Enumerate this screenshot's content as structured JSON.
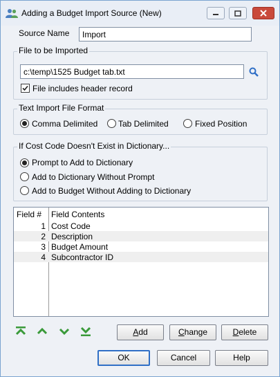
{
  "window": {
    "title": "Adding a Budget Import Source  (New)"
  },
  "source": {
    "label": "Source Name",
    "value": "Import"
  },
  "file_group": {
    "label": "File to be Imported",
    "path": "c:\\temp\\1525 Budget tab.txt",
    "header_checkbox_label": "File includes header record",
    "header_checked": true
  },
  "format_group": {
    "label": "Text Import File Format",
    "options": [
      "Comma Delimited",
      "Tab Delimited",
      "Fixed Position"
    ],
    "selected": 0
  },
  "cost_group": {
    "label": "If Cost Code Doesn't Exist in Dictionary...",
    "options": [
      "Prompt to Add to Dictionary",
      "Add to Dictionary Without Prompt",
      "Add to Budget Without Adding to Dictionary"
    ],
    "selected": 0
  },
  "fields": {
    "col_number": "Field #",
    "col_contents": "Field Contents",
    "rows": [
      {
        "num": "1",
        "contents": "Cost Code"
      },
      {
        "num": "2",
        "contents": "Description"
      },
      {
        "num": "3",
        "contents": "Budget Amount"
      },
      {
        "num": "4",
        "contents": "Subcontractor ID"
      }
    ]
  },
  "buttons": {
    "add": {
      "pre": "",
      "u": "A",
      "post": "dd"
    },
    "change": {
      "pre": "",
      "u": "C",
      "post": "hange"
    },
    "delete": {
      "pre": "",
      "u": "D",
      "post": "elete"
    },
    "ok": "OK",
    "cancel": "Cancel",
    "help": "Help"
  },
  "colors": {
    "arrow_green": "#3a9a3a",
    "close_red": "#c94a3b",
    "default_border": "#2f6fc6"
  }
}
